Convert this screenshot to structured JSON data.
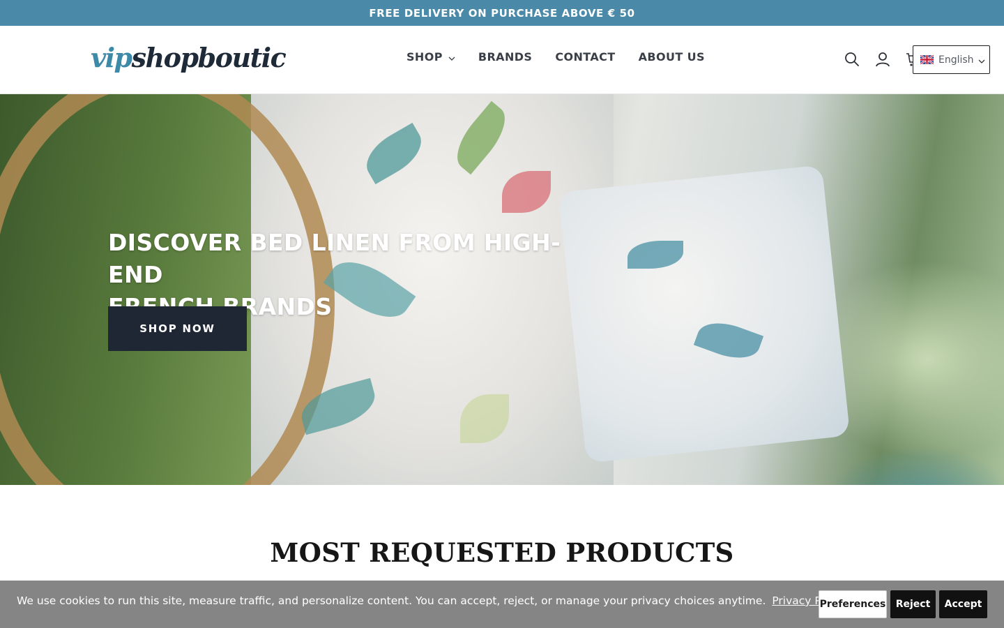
{
  "announcement": {
    "text": "FREE DELIVERY ON PURCHASE ABOVE € 50"
  },
  "header": {
    "logo": {
      "part1": "vip",
      "part2": "shopboutic"
    },
    "nav": [
      {
        "label": "SHOP",
        "has_dropdown": true
      },
      {
        "label": "BRANDS"
      },
      {
        "label": "CONTACT"
      },
      {
        "label": "ABOUT US"
      }
    ],
    "icons": [
      "search-icon",
      "account-icon",
      "cart-icon"
    ],
    "language": {
      "label": "English",
      "flag": "uk-flag-icon"
    }
  },
  "hero": {
    "title_line1": "DISCOVER BED LINEN FROM HIGH-END",
    "title_line2": "FRENCH BRANDS",
    "cta": "SHOP NOW"
  },
  "section": {
    "title": "MOST REQUESTED PRODUCTS"
  },
  "cookie_banner": {
    "text": "We use cookies to run this site, measure traffic, and personalize content. You can accept, reject, or manage your privacy choices anytime.",
    "link": "Privacy Policy",
    "buttons": {
      "preferences": "Preferences",
      "reject": "Reject",
      "accept": "Accept"
    }
  },
  "colors": {
    "announcement_bg": "#4a8aa8",
    "logo_accent": "#3d8aa8",
    "logo_dark": "#1e2a38",
    "cta_bg": "#1f2735",
    "cookie_bg": "#858585"
  }
}
